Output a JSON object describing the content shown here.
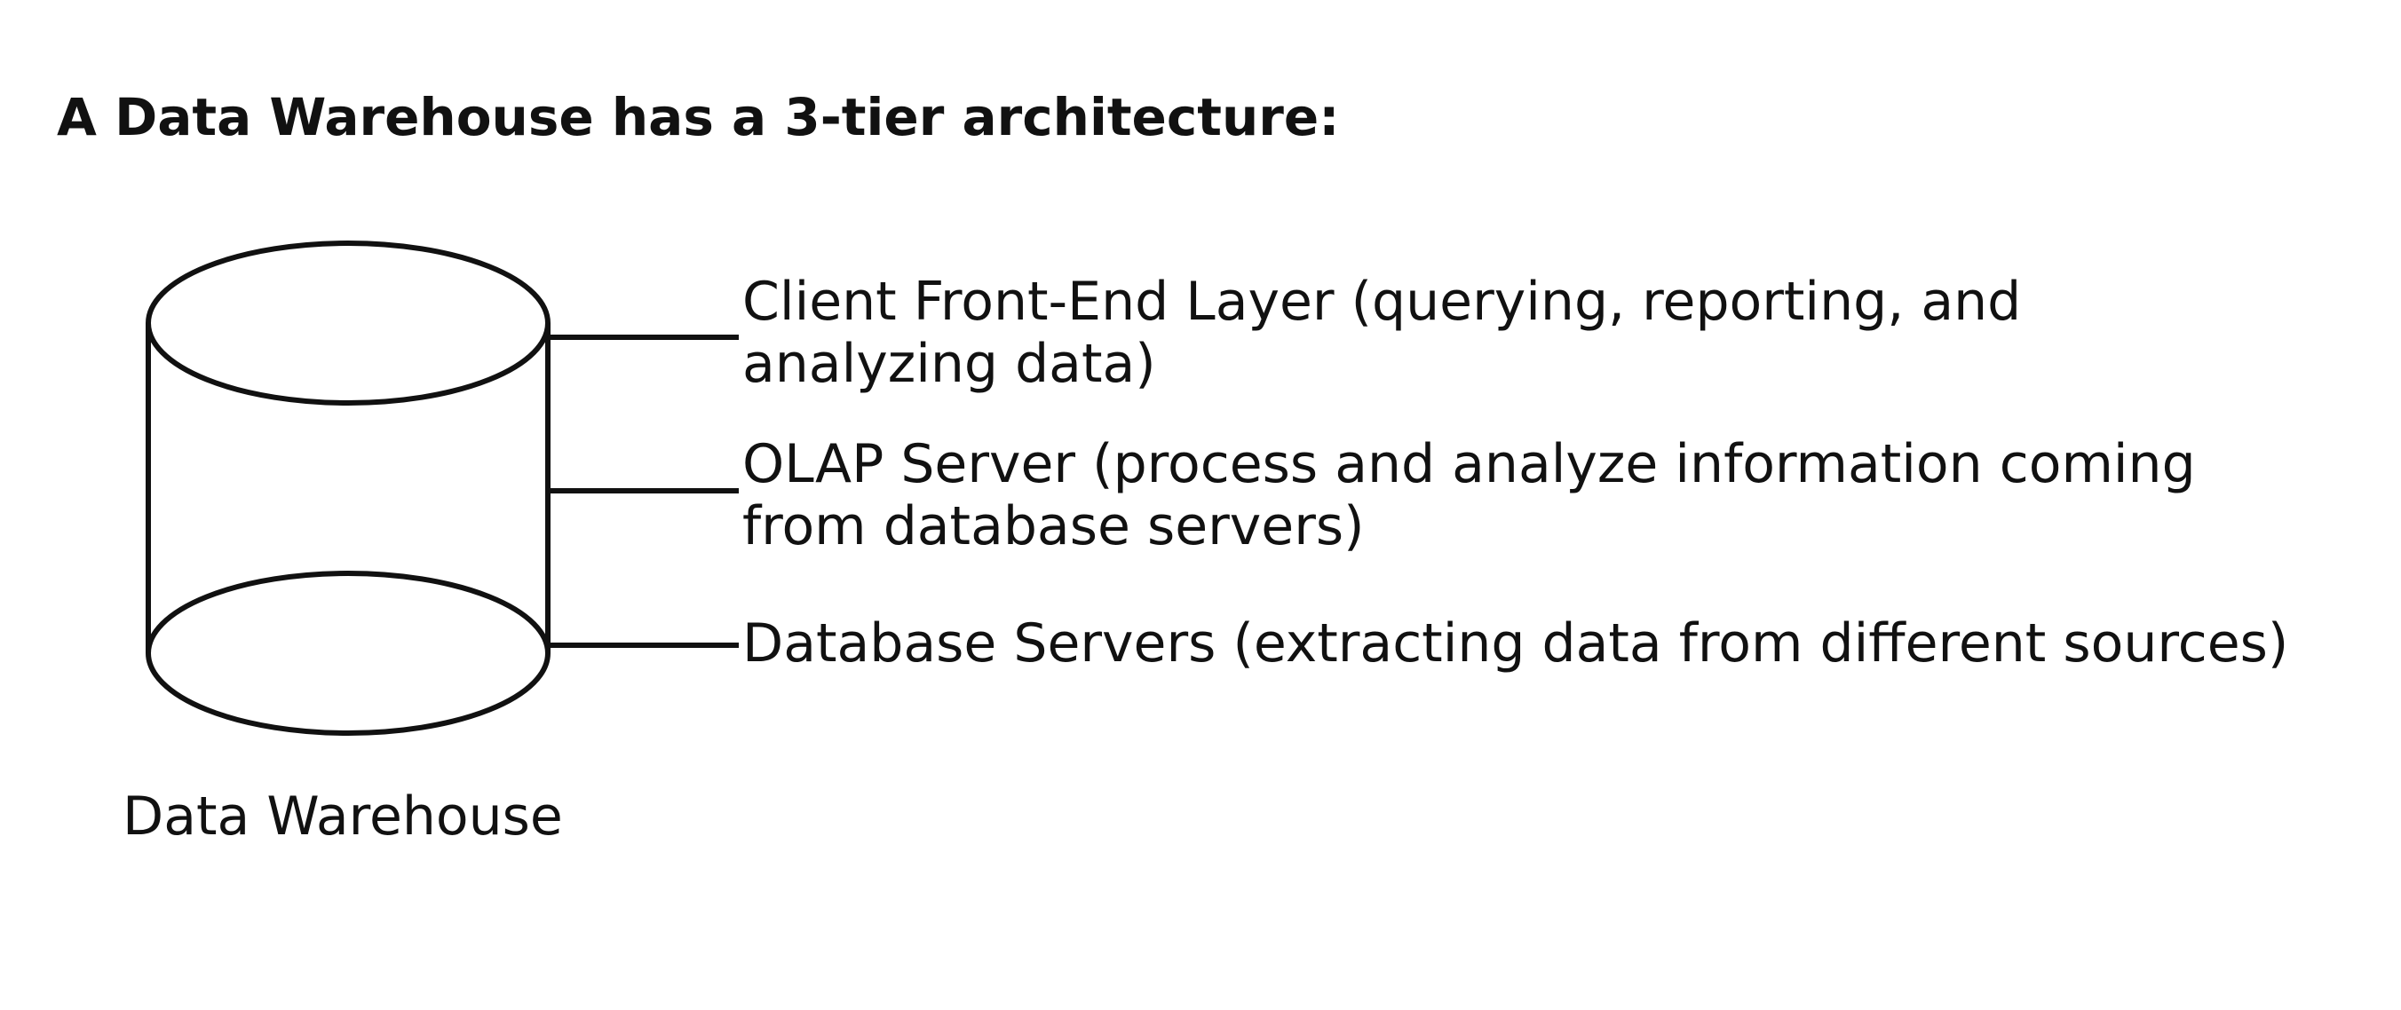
{
  "heading": "A Data Warehouse has a 3-tier architecture:",
  "diagram": {
    "cylinder_icon": "database-cylinder-icon",
    "stroke_color": "#111111",
    "caption": "Data Warehouse",
    "tiers": [
      {
        "lines": [
          "Client Front-End Layer (querying, reporting, and",
          "analyzing data)"
        ]
      },
      {
        "lines": [
          "OLAP Server (process and analyze information coming",
          "from database servers)"
        ]
      },
      {
        "lines": [
          "Database Servers (extracting data from different sources)"
        ]
      }
    ]
  }
}
